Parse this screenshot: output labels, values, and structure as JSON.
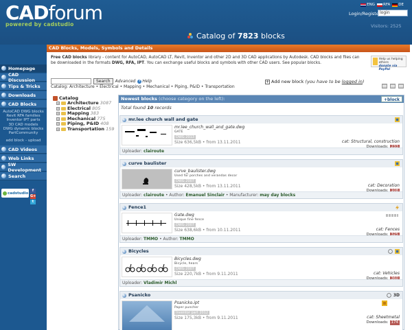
{
  "header": {
    "logo_main": "CAD",
    "logo_forum": "forum",
    "logo_sub": "powered by cadstudio",
    "catalog_prefix": "Catalog of ",
    "catalog_count": "7823",
    "catalog_suffix": " blocks",
    "flags": [
      "ENG",
      "RFA",
      "DE"
    ],
    "login_label": "Login/Register:",
    "login_value": "login",
    "visitors": "Visitors: 2525"
  },
  "sidebar": {
    "items": [
      {
        "label": "Homepage"
      },
      {
        "label": "CAD Discussion"
      },
      {
        "label": "Tips & Tricks"
      },
      {
        "label": "Downloads"
      },
      {
        "label": "CAD Blocks"
      }
    ],
    "sublinks": [
      "AutoCAD DWG blocks",
      "Revit RFA families",
      "Inventor IPT parts",
      "3D CAD models",
      "DWG dynamic blocks",
      "PartCommunity",
      "",
      "add block - upload"
    ],
    "items2": [
      {
        "label": "CAD Videos"
      },
      {
        "label": "Web Links"
      },
      {
        "label": "SW Development"
      },
      {
        "label": "Search"
      }
    ],
    "badge": "cadstudio",
    "social": [
      "f",
      "G+",
      "t"
    ]
  },
  "main": {
    "section_title": "CAD Blocks, Models, Symbols and Details",
    "intro_bold": "Free CAD blocks",
    "intro_text": " library - content for AutoCAD, AutoCAD LT, Revit, Inventor and other 2D and 3D CAD applications by Autodesk. CAD blocks and files can be downloaded in the formats ",
    "intro_formats": "DWG, RFA, IPT",
    "intro_text2": ". You can exchange useful blocks and symbols with other CAD users. See popular blocks.",
    "paypal_text": "Help us helping others",
    "paypal_brand": "donate via PayPal",
    "search_btn": "Search",
    "advanced": "Advanced",
    "help": "Help",
    "add_block": "Add new block",
    "add_block_note_pre": "(you have to be ",
    "add_block_note_link": "logged in",
    "add_block_note_post": ")",
    "breadcrumb_label": "Catalog:",
    "breadcrumb": "Architecture • Electrical • Mapping • Mechanical • Piping, P&ID • Transportation"
  },
  "tree": {
    "title": "Catalog",
    "items": [
      {
        "name": "Architecture",
        "count": "3087"
      },
      {
        "name": "Electrical",
        "count": "805"
      },
      {
        "name": "Mapping",
        "count": "383"
      },
      {
        "name": "Mechanical",
        "count": "775"
      },
      {
        "name": "Piping, P&ID",
        "count": "408"
      },
      {
        "name": "Transportation",
        "count": "159"
      }
    ]
  },
  "newest": {
    "title": "Newest blocks",
    "note": " (choose category on the left):",
    "block_btn": "+block",
    "found_pre": "Total found ",
    "found_count": "10",
    "found_post": " records",
    "cards": [
      {
        "title": "mr.lee church wall and gate",
        "file": "mr.lee_church_wall_and_gate.dwg",
        "desc": "GATE",
        "tag": "DWG 2013",
        "size": "Size 636,5kB • from 13.11.2011",
        "cat": "cat: Structural, construction",
        "downloads": "Downloads:",
        "dl_count": "233",
        "foot_label": "Uploader: ",
        "foot_value": "clairoute"
      },
      {
        "title": "curve baulister",
        "file": "curve_baulister.dwg",
        "desc": "Used for porches and verandas decor",
        "tag": "DWG 2007",
        "size": "Size 428,5kB • from 13.11.2011",
        "cat": "cat: Decoration",
        "downloads": "Downloads:",
        "dl_count": "108",
        "foot_label": "Uploader: ",
        "foot_value": "clairoute",
        "foot_extra": " • Author: ",
        "foot_value2": "Emanuel Sinclair",
        "foot_extra2": " • Manufacturer: ",
        "foot_value3": "may day blocks"
      },
      {
        "title": "Fence1",
        "file": "Gate.dwg",
        "desc": "Unique fine fence",
        "tag": "DWG 2007",
        "size": "Size 638,6kB • from 10.11.2011",
        "cat": "cat: Fences",
        "downloads": "Downloads:",
        "dl_count": "325",
        "foot_label": "Uploader: ",
        "foot_value": "TMMO",
        "foot_extra": " • Author: ",
        "foot_value2": "TMMO"
      },
      {
        "title": "Bicycles",
        "file": "Bicycles.dwg",
        "desc": "Bicycle, hears",
        "tag": "DWG 2007",
        "size": "Size 220,7kB • from 9.11.2011",
        "cat": "cat: Vehicles",
        "downloads": "Downloads:",
        "dl_count": "360",
        "foot_label": "Uploader: ",
        "foot_value": "Vladimir Michl"
      },
      {
        "title": "Psanicko",
        "badge": "3D",
        "file": "Psanicko.ipt",
        "desc": "Paper puncher",
        "tag": "Inventor part 2012",
        "size": "Size 175,3kB • from 9.11.2011",
        "cat": "cat: Sheetmetal",
        "downloads": "Downloads:",
        "dl_count": "174"
      }
    ]
  },
  "colors": {
    "header_bg": "#1f5c93",
    "sidebar_bg": "#1c5890",
    "section_bar": "#e87a27",
    "newest_bar": "#5a86b5",
    "download_badge": "#b55a55"
  }
}
